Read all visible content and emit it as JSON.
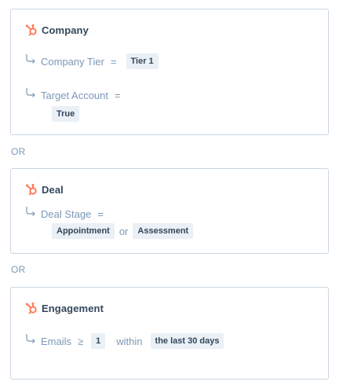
{
  "filters": [
    {
      "object": "Company",
      "conditions": [
        {
          "property": "Company Tier",
          "operator": "=",
          "values": [
            "Tier 1"
          ]
        },
        {
          "property": "Target Account",
          "operator": "=",
          "values": [
            "True"
          ]
        }
      ]
    },
    {
      "object": "Deal",
      "conditions": [
        {
          "property": "Deal Stage",
          "operator": "=",
          "values": [
            "Appointment",
            "Assessment"
          ],
          "joiner": "or"
        }
      ]
    },
    {
      "object": "Engagement",
      "conditions": [
        {
          "property": "Emails",
          "operator": "≥",
          "values": [
            "1"
          ],
          "joiner": "within",
          "timeframe": "the last 30 days"
        }
      ]
    }
  ],
  "separators": [
    "OR",
    "OR"
  ],
  "icon": "hubspot-sprocket-icon",
  "colors": {
    "accent": "#ff7a59",
    "text": "#33475b",
    "muted": "#7c98b6",
    "pill_bg": "#eaf0f6",
    "border": "#cbd6e2"
  }
}
